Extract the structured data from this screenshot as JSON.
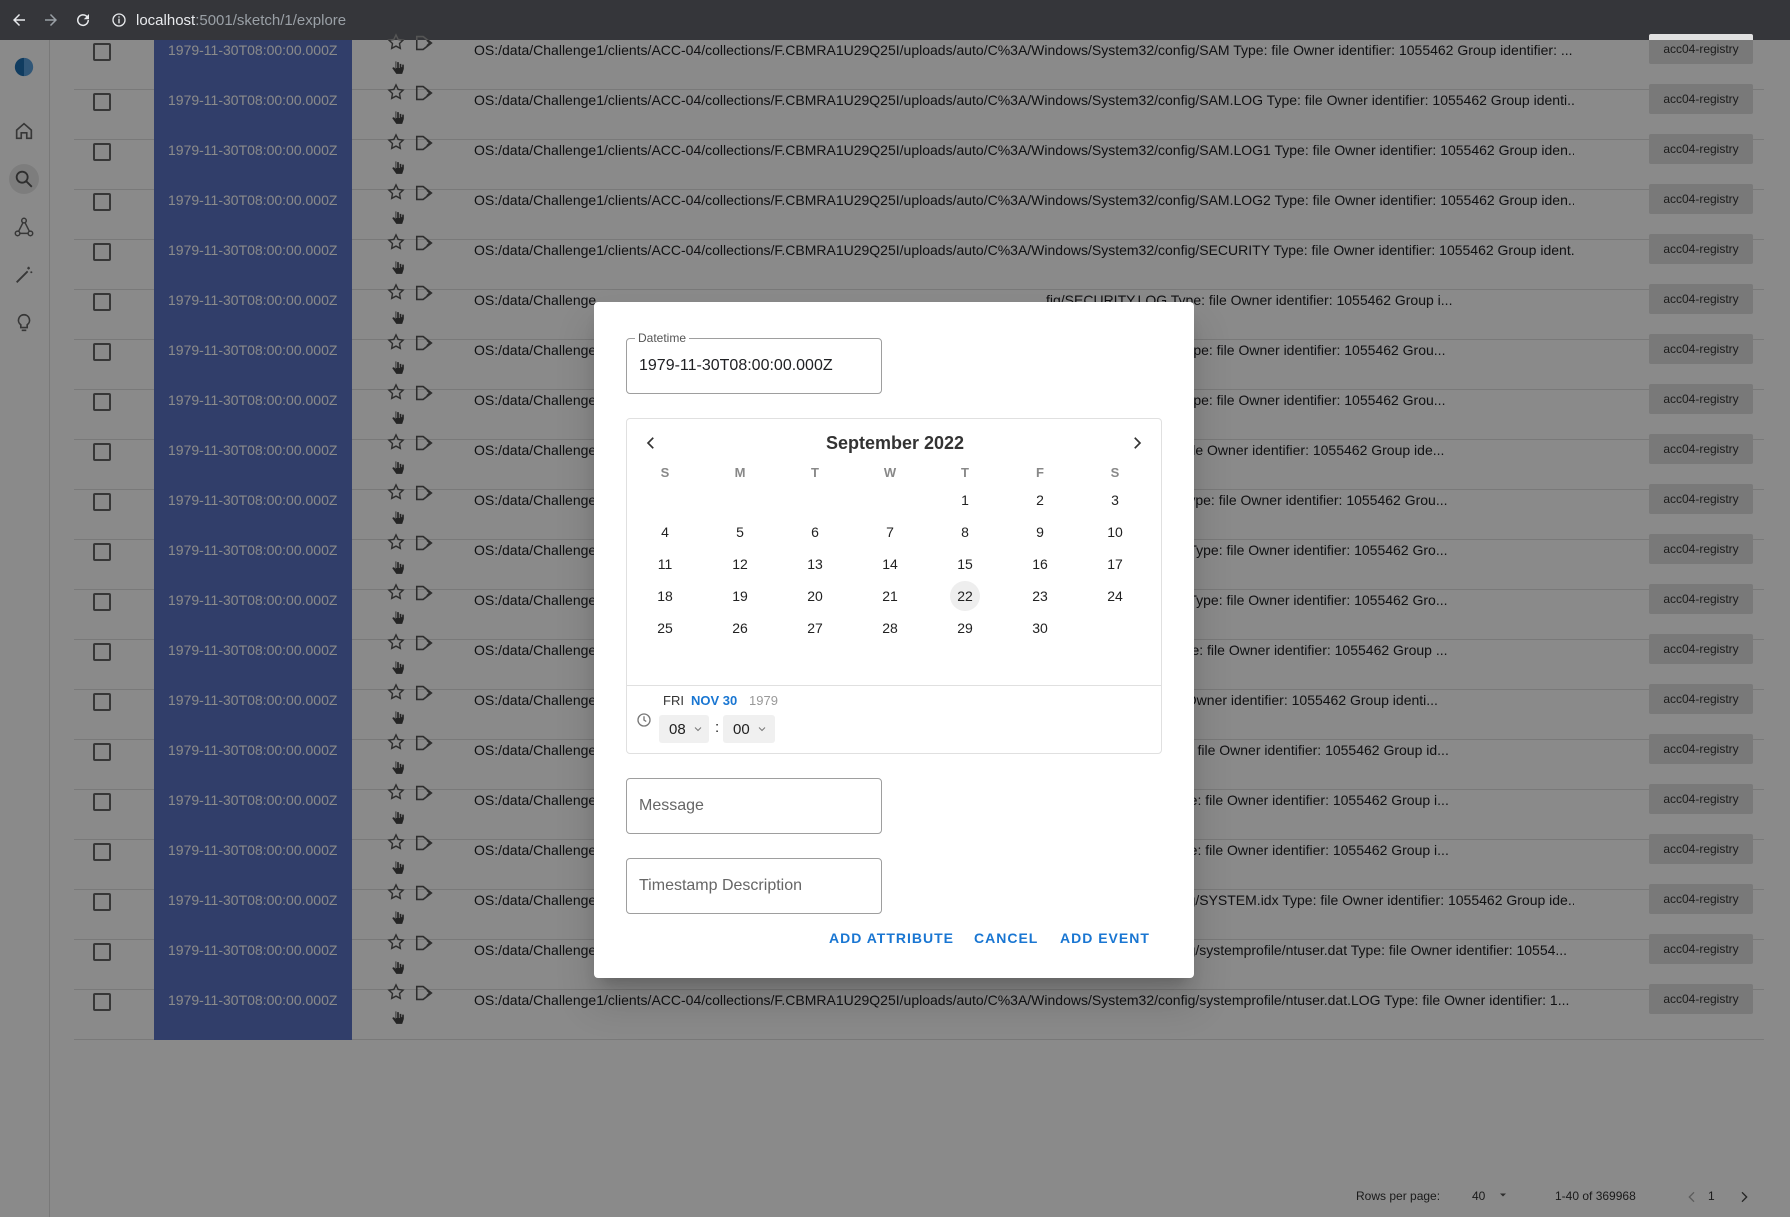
{
  "browser": {
    "url_host": "localhost",
    "url_path": ":5001/sketch/1/explore"
  },
  "rail": {
    "icons": [
      "logo-icon",
      "home-icon",
      "search-icon",
      "graph-icon",
      "magic-wand-icon",
      "lightbulb-icon"
    ]
  },
  "table": {
    "rows": [
      {
        "datetime": "1979-11-30T08:00:00.000Z",
        "message": "OS:/data/Challenge1/clients/ACC-04/collections/F.CBMRA1U29Q25I/uploads/auto/C%3A/Windows/System32/config/SAM Type: file Owner identifier: 1055462 Group identifier: ...",
        "tag": "acc04-registry"
      },
      {
        "datetime": "1979-11-30T08:00:00.000Z",
        "message": "OS:/data/Challenge1/clients/ACC-04/collections/F.CBMRA1U29Q25I/uploads/auto/C%3A/Windows/System32/config/SAM.LOG Type: file Owner identifier: 1055462 Group identi...",
        "tag": "acc04-registry"
      },
      {
        "datetime": "1979-11-30T08:00:00.000Z",
        "message": "OS:/data/Challenge1/clients/ACC-04/collections/F.CBMRA1U29Q25I/uploads/auto/C%3A/Windows/System32/config/SAM.LOG1 Type: file Owner identifier: 1055462 Group iden...",
        "tag": "acc04-registry"
      },
      {
        "datetime": "1979-11-30T08:00:00.000Z",
        "message": "OS:/data/Challenge1/clients/ACC-04/collections/F.CBMRA1U29Q25I/uploads/auto/C%3A/Windows/System32/config/SAM.LOG2 Type: file Owner identifier: 1055462 Group iden...",
        "tag": "acc04-registry"
      },
      {
        "datetime": "1979-11-30T08:00:00.000Z",
        "message": "OS:/data/Challenge1/clients/ACC-04/collections/F.CBMRA1U29Q25I/uploads/auto/C%3A/Windows/System32/config/SECURITY Type: file Owner identifier: 1055462 Group ident...",
        "tag": "acc04-registry"
      },
      {
        "datetime": "1979-11-30T08:00:00.000Z",
        "message": "OS:/data/Challenge",
        "message_tail": "fig/SECURITY.LOG Type: file Owner identifier: 1055462 Group i...",
        "tag": "acc04-registry"
      },
      {
        "datetime": "1979-11-30T08:00:00.000Z",
        "message": "OS:/data/Challenge",
        "message_tail": "fig/SECURITY.LOG1 Type: file Owner identifier: 1055462 Grou...",
        "tag": "acc04-registry"
      },
      {
        "datetime": "1979-11-30T08:00:00.000Z",
        "message": "OS:/data/Challenge",
        "message_tail": "fig/SECURITY.LOG2 Type: file Owner identifier: 1055462 Grou...",
        "tag": "acc04-registry"
      },
      {
        "datetime": "1979-11-30T08:00:00.000Z",
        "message": "OS:/data/Challenge",
        "message_tail": "fig/SOFTWARE Type: file Owner identifier: 1055462 Group ide...",
        "tag": "acc04-registry"
      },
      {
        "datetime": "1979-11-30T08:00:00.000Z",
        "message": "OS:/data/Challenge",
        "message_tail": "fig/SOFTWARE.LOG Type: file Owner identifier: 1055462 Grou...",
        "tag": "acc04-registry"
      },
      {
        "datetime": "1979-11-30T08:00:00.000Z",
        "message": "OS:/data/Challenge",
        "message_tail": "fig/SOFTWARE.LOG1 Type: file Owner identifier: 1055462 Gro...",
        "tag": "acc04-registry"
      },
      {
        "datetime": "1979-11-30T08:00:00.000Z",
        "message": "OS:/data/Challenge",
        "message_tail": "fig/SOFTWARE.LOG2 Type: file Owner identifier: 1055462 Gro...",
        "tag": "acc04-registry"
      },
      {
        "datetime": "1979-11-30T08:00:00.000Z",
        "message": "OS:/data/Challenge",
        "message_tail": "fig/SOFTWARE.idx Type: file Owner identifier: 1055462 Group ...",
        "tag": "acc04-registry"
      },
      {
        "datetime": "1979-11-30T08:00:00.000Z",
        "message": "OS:/data/Challenge",
        "message_tail": "fig/SYSTEM Type: file Owner identifier: 1055462 Group identi...",
        "tag": "acc04-registry"
      },
      {
        "datetime": "1979-11-30T08:00:00.000Z",
        "message": "OS:/data/Challenge",
        "message_tail": "fig/SYSTEM.LOG Type: file Owner identifier: 1055462 Group id...",
        "tag": "acc04-registry"
      },
      {
        "datetime": "1979-11-30T08:00:00.000Z",
        "message": "OS:/data/Challenge",
        "message_tail": "fig/SYSTEM.LOG1 Type: file Owner identifier: 1055462 Group i...",
        "tag": "acc04-registry"
      },
      {
        "datetime": "1979-11-30T08:00:00.000Z",
        "message": "OS:/data/Challenge",
        "message_tail": "fig/SYSTEM.LOG2 Type: file Owner identifier: 1055462 Group i...",
        "tag": "acc04-registry"
      },
      {
        "datetime": "1979-11-30T08:00:00.000Z",
        "message": "OS:/data/Challenge1/clients/ACC-04/collections/F.CBMRA1U29Q25I/uploads/auto/C%3A/Windows/System32/config/SYSTEM.idx Type: file Owner identifier: 1055462 Group ide...",
        "tag": "acc04-registry"
      },
      {
        "datetime": "1979-11-30T08:00:00.000Z",
        "message": "OS:/data/Challenge1/clients/ACC-04/collections/F.CBMRA1U29Q25I/uploads/auto/C%3A/Windows/System32/config/systemprofile/ntuser.dat Type: file Owner identifier: 10554...",
        "tag": "acc04-registry"
      },
      {
        "datetime": "1979-11-30T08:00:00.000Z",
        "message": "OS:/data/Challenge1/clients/ACC-04/collections/F.CBMRA1U29Q25I/uploads/auto/C%3A/Windows/System32/config/systemprofile/ntuser.dat.LOG Type: file Owner identifier: 1...",
        "tag": "acc04-registry"
      }
    ]
  },
  "footer": {
    "rows_per_page_label": "Rows per page:",
    "rows_per_page_value": "40",
    "range_label": "1-40 of 369968",
    "page": "1"
  },
  "dialog": {
    "datetime_label": "Datetime",
    "datetime_value": "1979-11-30T08:00:00.000Z",
    "calendar": {
      "month_label": "September 2022",
      "weekdays": [
        "S",
        "M",
        "T",
        "W",
        "T",
        "F",
        "S"
      ],
      "first_weekday_index": 4,
      "days_in_month": 30,
      "highlighted_day": 22
    },
    "selected": {
      "weekday": "FRI",
      "month_day": "NOV 30",
      "year": "1979",
      "hour": "08",
      "minute": "00",
      "separator": ":"
    },
    "message_placeholder": "Message",
    "timestamp_placeholder": "Timestamp Description",
    "actions": {
      "add_attribute": "ADD ATTRIBUTE",
      "cancel": "CANCEL",
      "add_event": "ADD EVENT"
    }
  }
}
